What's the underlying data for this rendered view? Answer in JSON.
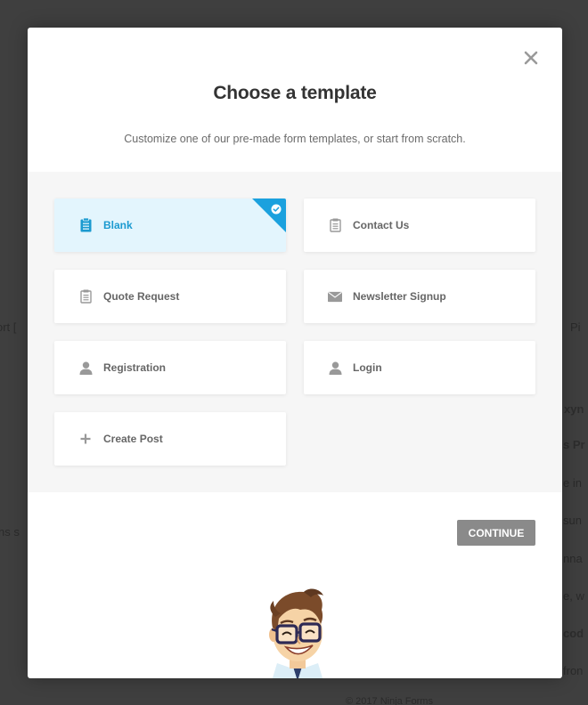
{
  "background": {
    "fragments": [
      "ort [",
      "Pi",
      "xyn",
      "s Pr",
      "e in",
      "sun",
      "nna",
      "e, w",
      "cod",
      "fron",
      "ns s",
      "© 2017 Ninja Forms"
    ]
  },
  "modal": {
    "close_icon": "close-icon",
    "title": "Choose a template",
    "subtitle": "Customize one of our pre-made form templates, or start from scratch.",
    "templates": [
      {
        "label": "Blank",
        "icon": "clipboard-icon",
        "selected": true
      },
      {
        "label": "Contact Us",
        "icon": "clipboard-icon",
        "selected": false
      },
      {
        "label": "Quote Request",
        "icon": "clipboard-icon",
        "selected": false
      },
      {
        "label": "Newsletter Signup",
        "icon": "envelope-icon",
        "selected": false
      },
      {
        "label": "Registration",
        "icon": "user-icon",
        "selected": false
      },
      {
        "label": "Login",
        "icon": "user-icon",
        "selected": false
      },
      {
        "label": "Create Post",
        "icon": "plus-icon",
        "selected": false
      }
    ],
    "continue_label": "CONTINUE"
  },
  "colors": {
    "accent": "#1ba1de",
    "selected_bg": "#e3f5fd",
    "button_gray": "#8a8a8a"
  }
}
